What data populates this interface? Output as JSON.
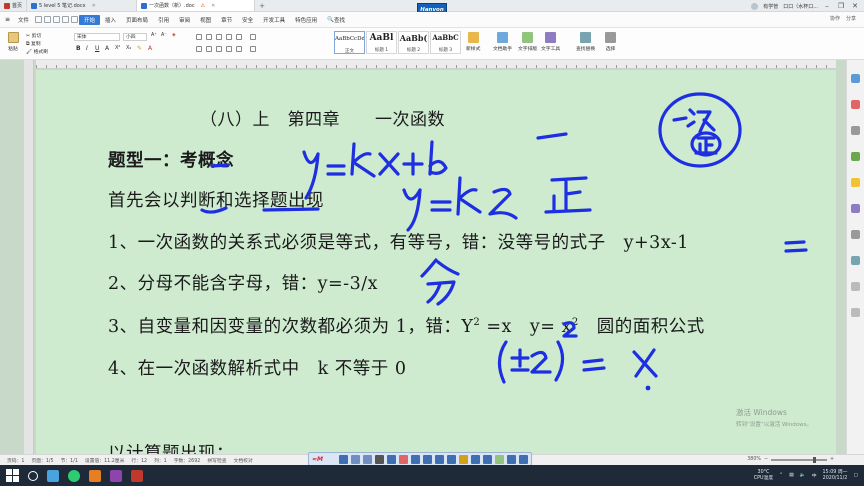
{
  "tabs": [
    {
      "label": "首页",
      "color": "#c0392b"
    },
    {
      "label": "5 level 5 笔记.docx",
      "color": "#2e6fd0"
    },
    {
      "label": "一次函数（新）.doc",
      "color": "#2e6fd0",
      "active": true
    }
  ],
  "tab_right": {
    "user": "有学管",
    "extra": "口口（水杯口...",
    "brand": "Hanvon"
  },
  "menu": {
    "file": "文件",
    "items": [
      "开始",
      "插入",
      "页面布局",
      "引用",
      "审阅",
      "视图",
      "章节",
      "安全",
      "开发工具",
      "特色应用"
    ],
    "search": "查找",
    "right": [
      "协作",
      "分享"
    ]
  },
  "ribbon": {
    "paste": "粘贴",
    "cut": "剪切",
    "copy": "复制",
    "format_painter": "格式刷",
    "font_name": "宋体",
    "font_size": "小四",
    "styles": [
      {
        "sample": "AaBbCcDd",
        "name": "正文"
      },
      {
        "sample": "AaBl",
        "name": "标题 1"
      },
      {
        "sample": "AaBb(",
        "name": "标题 2"
      },
      {
        "sample": "AaBbC",
        "name": "标题 3"
      }
    ],
    "new_style": "新样式",
    "text_assistant": "文档助手",
    "text_layout": "文字排版",
    "text_tools": "文字工具",
    "find_replace": "查找替换",
    "select": "选择"
  },
  "document": {
    "chapter": "（八）上　第四章　　一次函数",
    "type1": "题型一：考概念",
    "line1": "首先会以判断和选择题出现",
    "item1": "1、一次函数的关系式必须是等式，有等号，错：没等号的式子　y+3x-1",
    "item2": "2、分母不能含字母，错：y=-3/x",
    "item3_prefix": "3、自变量和因变量的次数都必须为 1，错：Y",
    "item3_sup1": "2",
    "item3_mid": " =x　y= x",
    "item3_sup2": "2",
    "item3_suffix": "　圆的面积公式",
    "item4": "4、在一次函数解析式中　k 不等于 0",
    "cut_line": "以计算题出现："
  },
  "watermark": {
    "line1": "激活 Windows",
    "line2": "转到“设置”以激活 Windows。"
  },
  "status": {
    "page": "页码：1",
    "pages": "页面：1/5",
    "section": "节：1/1",
    "position": "设置值：11.2厘米",
    "row": "行：12",
    "col": "列：1",
    "words": "字数：2692",
    "spell": "拼写检查",
    "proof": "文档校对",
    "zoom": "380%"
  },
  "taskbar": {
    "weather": "30°C",
    "cpu": "CPU温度",
    "time": "15:09 周一",
    "date": "2020/11/2"
  },
  "colors": {
    "accent": "#3479d6",
    "ink": "#1d2fe0",
    "page": "#ceebd0"
  }
}
